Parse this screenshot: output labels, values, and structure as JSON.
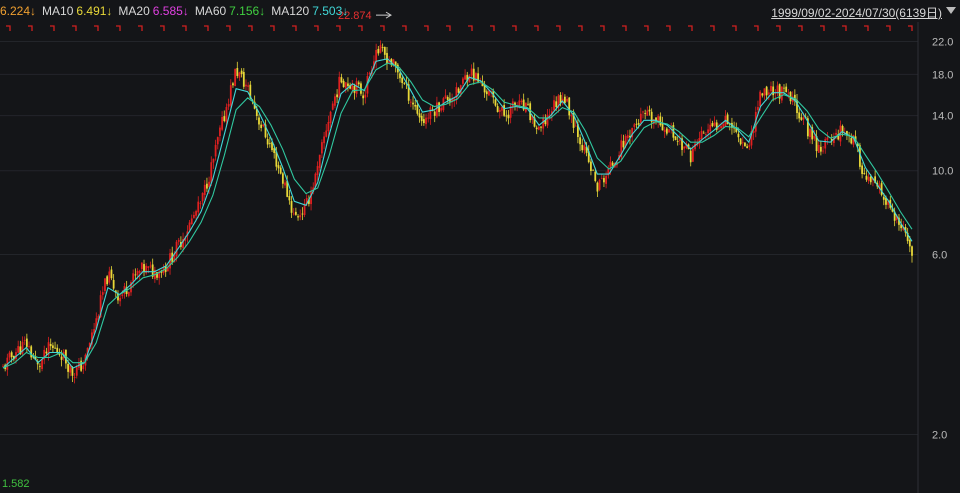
{
  "ma_indicators": [
    {
      "label": "",
      "value": "6.224",
      "arrow": "↓",
      "color": "#f0a030"
    },
    {
      "label": "MA10",
      "value": "6.491",
      "arrow": "↓",
      "color": "#e8d838"
    },
    {
      "label": "MA20",
      "value": "6.585",
      "arrow": "↓",
      "color": "#e040e0"
    },
    {
      "label": "MA60",
      "value": "7.156",
      "arrow": "↓",
      "color": "#40d040"
    },
    {
      "label": "MA120",
      "value": "7.503",
      "arrow": "↓",
      "color": "#40d8d8"
    }
  ],
  "date_range": "1999/09/02-2024/07/30(6139日)",
  "dropdown_icon": "triangle-down-icon",
  "colors": {
    "up": "#e02020",
    "down": "#e8d838",
    "ma_a": "#40d8d8",
    "ma_b": "#30c8a0",
    "grid": "#23252a",
    "tick_text": "#bbbbbb",
    "marker": "#d02020"
  },
  "chart_data": {
    "type": "candlestick",
    "title": "",
    "x_range": [
      "1999/09/02",
      "2024/07/30"
    ],
    "ylim": [
      1.4,
      23.6
    ],
    "y_scale": "log",
    "y_ticks": [
      "22.0",
      "18.0",
      "14.0",
      "10.0",
      "6.0",
      "2.0"
    ],
    "grid": true,
    "high_label": "22.874",
    "low_label": "1.582",
    "series": [
      {
        "name": "close",
        "values": [
          3.0,
          3.3,
          3.5,
          3.0,
          3.4,
          3.3,
          2.9,
          3.1,
          4.0,
          5.3,
          4.6,
          5.1,
          5.5,
          5.4,
          5.6,
          6.3,
          7.2,
          8.2,
          10.5,
          14.0,
          18.5,
          16.5,
          13.5,
          11.5,
          9.5,
          7.5,
          8.0,
          10.0,
          14.0,
          17.5,
          17.0,
          16.0,
          21.0,
          20.0,
          18.0,
          15.5,
          13.5,
          14.5,
          15.5,
          16.0,
          18.5,
          17.0,
          15.5,
          14.0,
          15.0,
          14.5,
          12.5,
          14.5,
          16.0,
          13.5,
          11.0,
          9.0,
          10.0,
          11.5,
          13.0,
          14.0,
          13.5,
          13.0,
          12.0,
          11.0,
          12.5,
          13.0,
          14.0,
          12.5,
          11.5,
          16.0,
          16.5,
          16.0,
          15.0,
          13.0,
          11.5,
          12.0,
          13.0,
          12.0,
          9.5,
          9.0,
          8.0,
          7.0,
          6.2
        ]
      },
      {
        "name": "",
        "values": [
          3.0,
          3.2,
          3.4,
          3.1,
          3.3,
          3.3,
          3.0,
          3.1,
          3.8,
          4.9,
          4.7,
          5.0,
          5.4,
          5.4,
          5.6,
          6.2,
          6.9,
          7.8,
          9.5,
          12.5,
          16.5,
          16.2,
          14.2,
          12.2,
          10.2,
          8.3,
          8.1,
          9.3,
          12.5,
          16.0,
          17.0,
          16.3,
          19.5,
          19.8,
          18.5,
          16.3,
          14.3,
          14.5,
          15.2,
          15.8,
          17.7,
          17.3,
          16.0,
          14.6,
          14.8,
          14.6,
          13.2,
          14.0,
          15.3,
          14.0,
          11.8,
          9.8,
          9.8,
          11.0,
          12.5,
          13.6,
          13.6,
          13.2,
          12.3,
          11.4,
          12.1,
          12.8,
          13.6,
          12.9,
          11.9,
          14.8,
          16.1,
          16.1,
          15.3,
          13.6,
          12.0,
          11.9,
          12.7,
          12.2,
          10.2,
          9.2,
          8.3,
          7.3,
          6.5
        ]
      },
      {
        "name": "",
        "values": [
          3.0,
          3.1,
          3.3,
          3.2,
          3.2,
          3.3,
          3.1,
          3.1,
          3.5,
          4.4,
          4.7,
          4.9,
          5.2,
          5.3,
          5.5,
          5.9,
          6.5,
          7.3,
          8.6,
          11.0,
          14.5,
          15.6,
          14.8,
          13.2,
          11.4,
          9.5,
          8.7,
          9.0,
          11.0,
          14.2,
          16.3,
          16.4,
          18.5,
          19.3,
          18.8,
          17.2,
          15.4,
          14.8,
          15.0,
          15.5,
          16.9,
          17.2,
          16.4,
          15.2,
          14.9,
          14.7,
          13.8,
          13.8,
          14.7,
          14.3,
          12.7,
          10.8,
          10.1,
          10.6,
          11.8,
          13.0,
          13.5,
          13.3,
          12.7,
          11.9,
          11.9,
          12.4,
          13.1,
          13.0,
          12.3,
          13.8,
          15.4,
          15.9,
          15.5,
          14.4,
          12.9,
          12.2,
          12.5,
          12.3,
          11.0,
          9.9,
          8.8,
          7.8,
          7.0
        ]
      }
    ]
  }
}
